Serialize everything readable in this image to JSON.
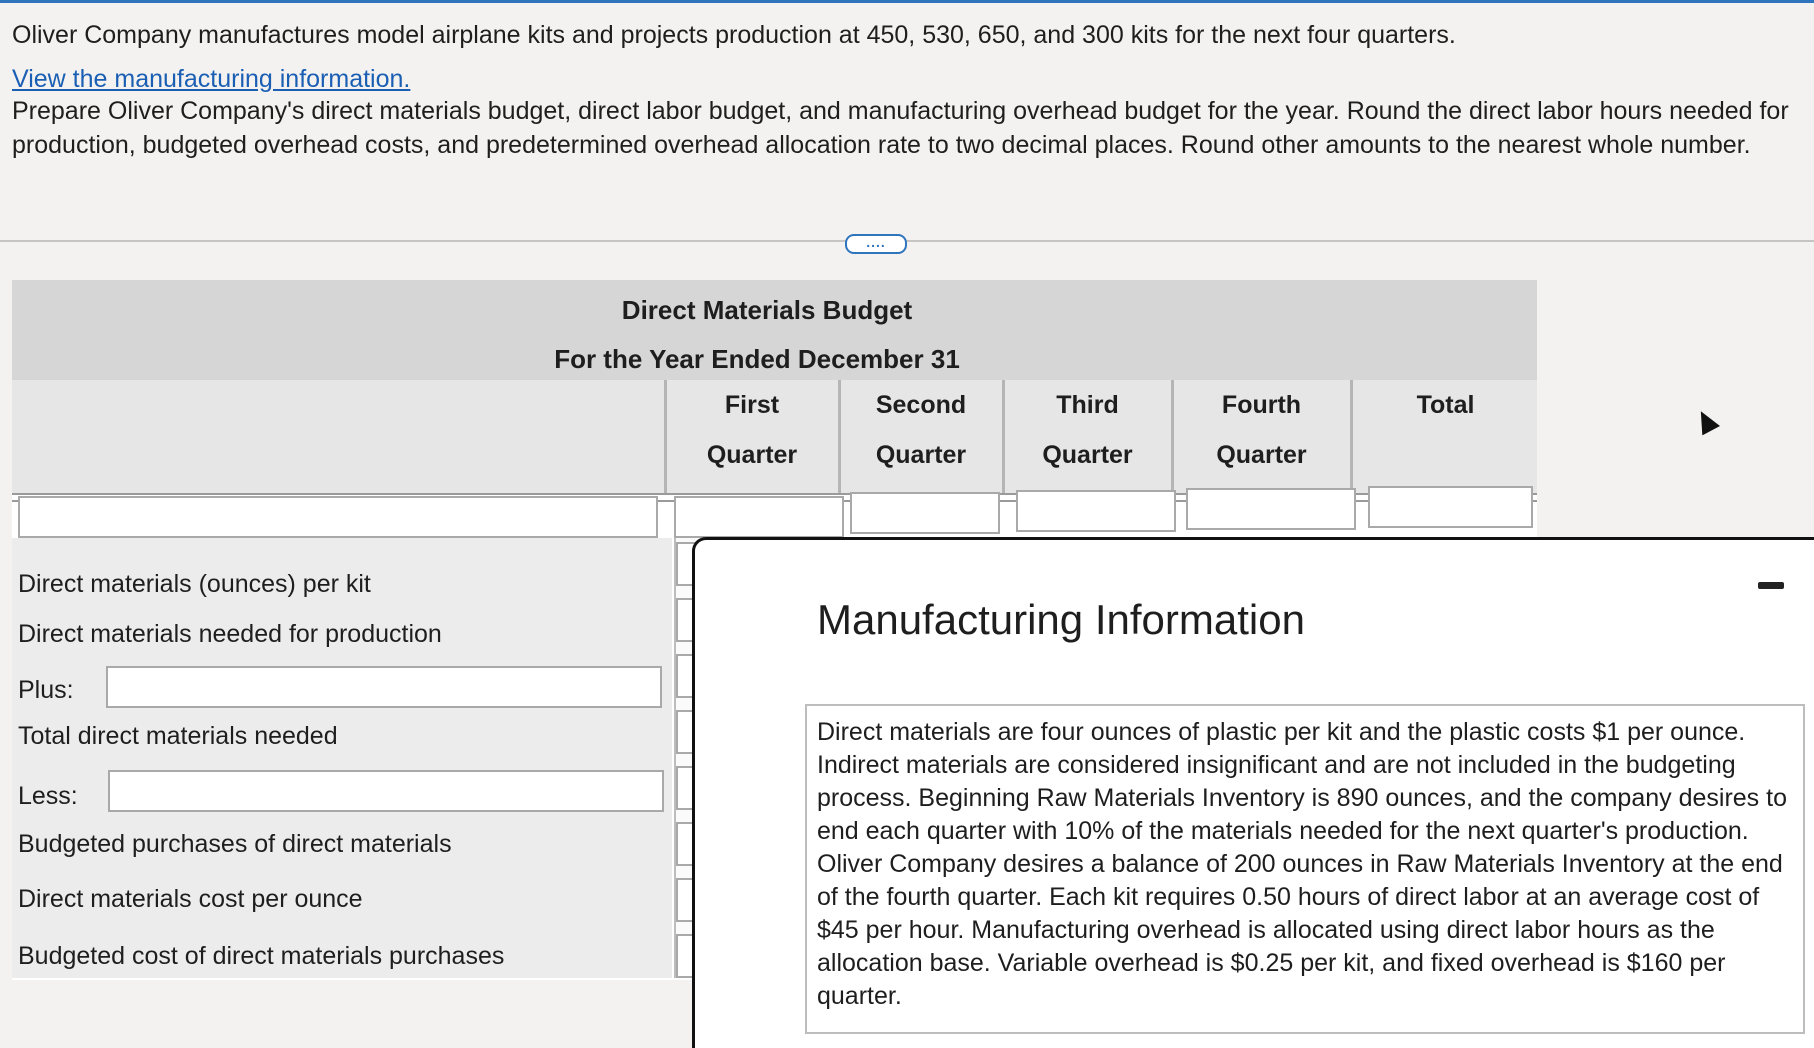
{
  "question": {
    "intro": "Oliver Company manufactures model airplane kits and projects production at 450, 530, 650, and 300 kits for the next four quarters.",
    "link_text": "View the manufacturing information.",
    "instructions": "Prepare Oliver Company's direct materials budget, direct labor budget, and manufacturing overhead budget for the year. Round the direct labor hours needed for production, budgeted overhead costs, and predetermined overhead allocation rate to two decimal places. Round other amounts to the nearest whole number."
  },
  "more_button": "....",
  "budget": {
    "title": "Direct Materials Budget",
    "subtitle": "For the Year Ended December 31",
    "columns": [
      {
        "line1": "First",
        "line2": "Quarter"
      },
      {
        "line1": "Second",
        "line2": "Quarter"
      },
      {
        "line1": "Third",
        "line2": "Quarter"
      },
      {
        "line1": "Fourth",
        "line2": "Quarter"
      },
      {
        "line1": "",
        "line2": "Total"
      }
    ],
    "rows": {
      "dm_per_kit": "Direct materials (ounces) per kit",
      "dm_needed": "Direct materials needed for production",
      "plus": "Plus:",
      "total_needed": "Total direct materials needed",
      "less": "Less:",
      "budgeted_purchases": "Budgeted purchases of direct materials",
      "cost_per_ounce": "Direct materials cost per ounce",
      "budgeted_cost": "Budgeted cost of direct materials purchases"
    }
  },
  "modal": {
    "title": "Manufacturing Information",
    "body": "Direct materials are four ounces of plastic per kit and the plastic costs $1 per ounce. Indirect materials are considered insignificant and are not included in the budgeting process. Beginning Raw Materials Inventory is 890 ounces, and the company desires to end each quarter with 10% of the materials needed for the next quarter's production. Oliver Company desires a balance of 200 ounces in Raw Materials Inventory at the end of the fourth quarter. Each kit requires 0.50 hours of direct labor at an average cost of $45 per hour. Manufacturing overhead is allocated using direct labor hours as the allocation base. Variable overhead is $0.25 per kit, and fixed overhead is $160 per quarter."
  }
}
